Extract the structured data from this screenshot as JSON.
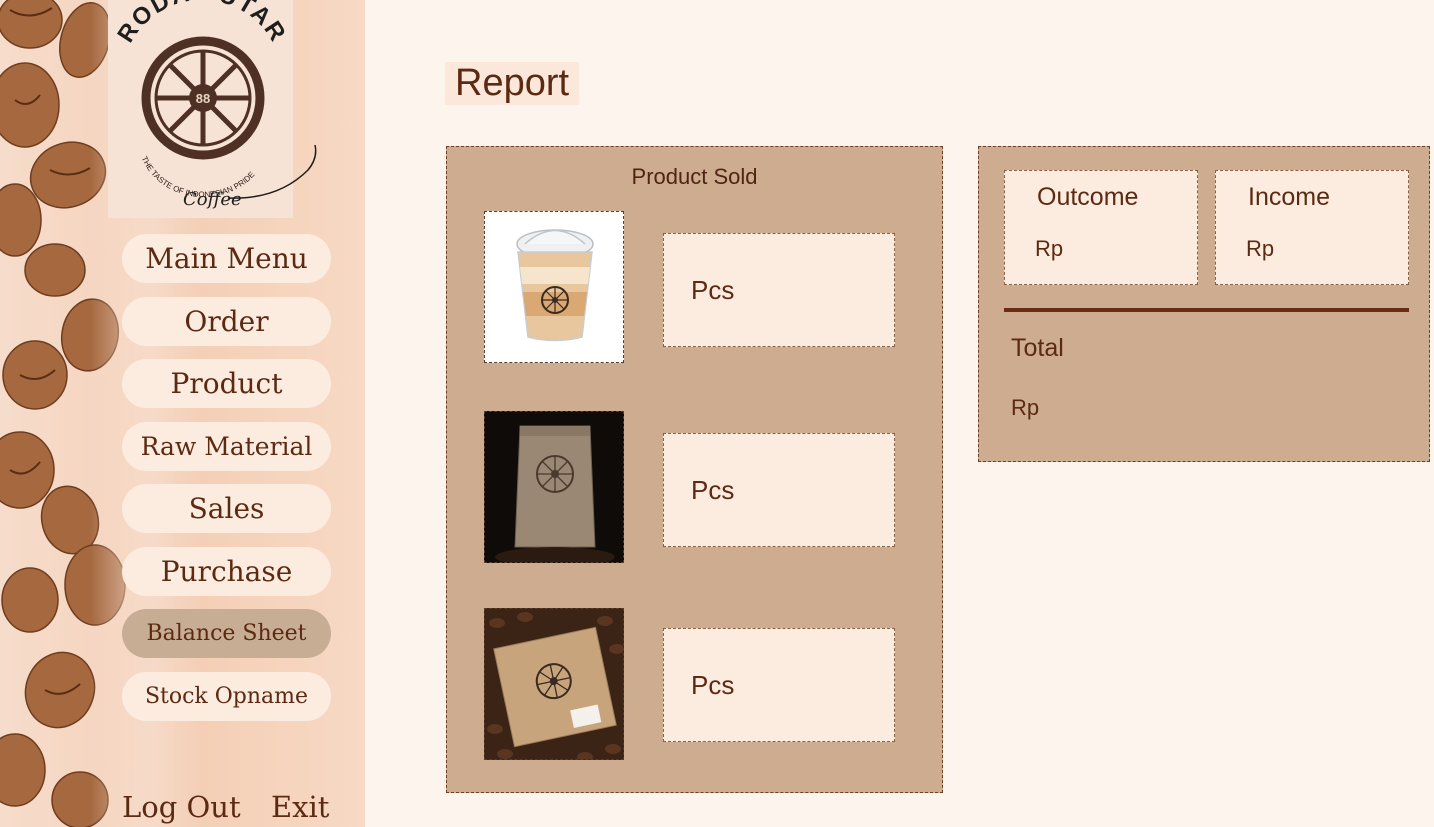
{
  "sidebar": {
    "logo": {
      "brand": "RODA PUTAR",
      "number": "88",
      "tagline": "THE TASTE OF INDONESIAN PRIDE",
      "script": "Coffee"
    },
    "nav": [
      {
        "label": "Main Menu"
      },
      {
        "label": "Order"
      },
      {
        "label": "Product"
      },
      {
        "label": "Raw Material"
      },
      {
        "label": "Sales"
      },
      {
        "label": "Purchase"
      },
      {
        "label": "Balance Sheet",
        "active": true
      },
      {
        "label": "Stock Opname"
      }
    ],
    "logout_label": "Log Out",
    "exit_label": "Exit"
  },
  "main": {
    "title": "Report",
    "product_sold": {
      "title": "Product Sold",
      "items": [
        {
          "image": "iced-coffee-cup-image",
          "unit": "Pcs"
        },
        {
          "image": "coffee-bag-image",
          "unit": "Pcs"
        },
        {
          "image": "coffee-box-image",
          "unit": "Pcs"
        }
      ]
    },
    "finance": {
      "outcome_label": "Outcome",
      "outcome_value": "Rp",
      "income_label": "Income",
      "income_value": "Rp",
      "total_label": "Total",
      "total_value": "Rp"
    }
  },
  "colors": {
    "accent": "#5c2a12",
    "panel": "#cdac8f",
    "button": "#fcece0",
    "active_button": "#c8ad95",
    "background": "#fdf4ee"
  }
}
